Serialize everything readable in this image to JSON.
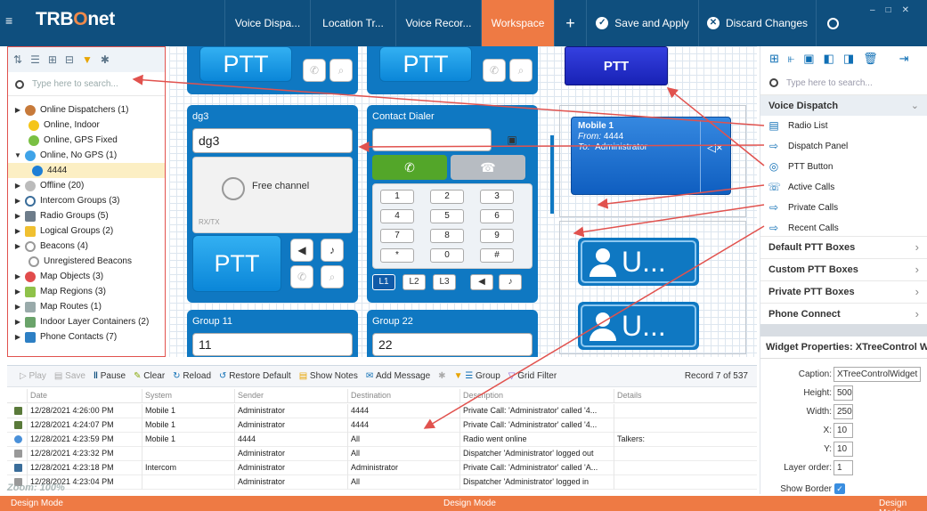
{
  "app": {
    "title_a": "TRB",
    "title_b": "O",
    "title_c": "net"
  },
  "tabs": [
    {
      "label": "Voice Dispa..."
    },
    {
      "label": "Location Tr..."
    },
    {
      "label": "Voice Recor..."
    },
    {
      "label": "Workspace"
    },
    {
      "label": "+"
    },
    {
      "label": "Save and Apply"
    },
    {
      "label": "Discard Changes"
    }
  ],
  "accent_color": "#ee7a44",
  "brand_color": "#0f4f7e",
  "left_panel": {
    "search_placeholder": "Type here to search...",
    "tree": [
      {
        "label": "Online Dispatchers (1)",
        "icon": "dispatcher-icon"
      },
      {
        "label": "Online, Indoor",
        "icon": "yellow-dot-icon"
      },
      {
        "label": "Online, GPS Fixed",
        "icon": "green-dot-icon"
      },
      {
        "label": "Online, No GPS (1)",
        "icon": "blue-dot-icon"
      },
      {
        "label": "4444",
        "icon": "walker-icon"
      },
      {
        "label": "Offline (20)",
        "icon": "grey-dot-icon"
      },
      {
        "label": "Intercom Groups (3)",
        "icon": "headset-icon"
      },
      {
        "label": "Radio Groups (5)",
        "icon": "radio-icon"
      },
      {
        "label": "Logical Groups (2)",
        "icon": "logical-icon"
      },
      {
        "label": "Beacons (4)",
        "icon": "beacon-icon"
      },
      {
        "label": "Unregistered Beacons",
        "icon": "beacon-icon"
      },
      {
        "label": "Map Objects (3)",
        "icon": "map-pin-icon"
      },
      {
        "label": "Map Regions (3)",
        "icon": "region-icon"
      },
      {
        "label": "Map Routes (1)",
        "icon": "route-icon"
      },
      {
        "label": "Indoor Layer Containers (2)",
        "icon": "indoor-icon"
      },
      {
        "label": "Phone Contacts (7)",
        "icon": "contacts-icon"
      }
    ]
  },
  "canvas": {
    "ptt_label": "PTT",
    "dg3_title": "dg3",
    "dg3_value": "dg3",
    "free_channel": "Free channel",
    "rxtx": "RX/TX",
    "contact_dialer_title": "Contact Dialer",
    "keys": [
      "1",
      "2",
      "3",
      "4",
      "5",
      "6",
      "7",
      "8",
      "9",
      "*",
      "0",
      "#"
    ],
    "lines": [
      "L1",
      "L2",
      "L3"
    ],
    "group11_title": "Group 11",
    "group11_value": "11",
    "group22_title": "Group 22",
    "group22_value": "22",
    "big_ptt": "PTT",
    "call_card": {
      "title": "Mobile 1",
      "from_label": "From:",
      "from_value": "4444",
      "to_label": "To:",
      "to_value": "Administrator"
    },
    "contact_tile_label": "U..."
  },
  "events": {
    "toolbar": {
      "play": "Play",
      "save": "Save",
      "pause": "Pause",
      "clear": "Clear",
      "reload": "Reload",
      "restore": "Restore Default",
      "show_notes": "Show Notes",
      "add_message": "Add Message",
      "group": "Group",
      "grid_filter": "Grid Filter",
      "record": "Record 7 of 537"
    },
    "columns": [
      "Date",
      "System",
      "Sender",
      "Destination",
      "Description",
      "Details"
    ],
    "rows": [
      {
        "icon": "radio-icon",
        "date": "12/28/2021 4:26:00 PM",
        "system": "Mobile 1",
        "sender": "Administrator",
        "destination": "4444",
        "description": "Private Call: 'Administrator' called '4...",
        "details": ""
      },
      {
        "icon": "radio-icon",
        "date": "12/28/2021 4:24:07 PM",
        "system": "Mobile 1",
        "sender": "Administrator",
        "destination": "4444",
        "description": "Private Call: 'Administrator' called '4...",
        "details": ""
      },
      {
        "icon": "info-icon",
        "date": "12/28/2021 4:23:59 PM",
        "system": "Mobile 1",
        "sender": "4444",
        "destination": "All",
        "description": "Radio went online",
        "details": "Talkers:"
      },
      {
        "icon": "logout-icon",
        "date": "12/28/2021 4:23:32 PM",
        "system": "",
        "sender": "Administrator",
        "destination": "All",
        "description": "Dispatcher 'Administrator' logged out",
        "details": ""
      },
      {
        "icon": "headset-icon",
        "date": "12/28/2021 4:23:18 PM",
        "system": "Intercom",
        "sender": "Administrator",
        "destination": "Administrator",
        "description": "Private Call: 'Administrator' called 'A...",
        "details": ""
      },
      {
        "icon": "login-icon",
        "date": "12/28/2021 4:23:04 PM",
        "system": "",
        "sender": "Administrator",
        "destination": "All",
        "description": "Dispatcher 'Administrator' logged in",
        "details": ""
      }
    ],
    "zoom_label": "Zoom: 100%"
  },
  "right_panel": {
    "search_placeholder": "Type here to search...",
    "voice_dispatch": "Voice Dispatch",
    "items": [
      {
        "label": "Radio List",
        "icon": "radio-list-icon"
      },
      {
        "label": "Dispatch Panel",
        "icon": "panel-icon"
      },
      {
        "label": "PTT Button",
        "icon": "ptt-icon"
      },
      {
        "label": "Active Calls",
        "icon": "active-calls-icon"
      },
      {
        "label": "Private Calls",
        "icon": "panel-icon"
      },
      {
        "label": "Recent Calls",
        "icon": "panel-icon"
      }
    ],
    "sections": [
      "Default PTT Boxes",
      "Custom PTT Boxes",
      "Private PTT Boxes",
      "Phone Connect"
    ],
    "props_title": "Widget Properties: XTreeControl W...",
    "props": [
      {
        "label": "Caption:",
        "value": "XTreeControlWidget"
      },
      {
        "label": "Height:",
        "value": "500"
      },
      {
        "label": "Width:",
        "value": "250"
      },
      {
        "label": "X:",
        "value": "10"
      },
      {
        "label": "Y:",
        "value": "10"
      },
      {
        "label": "Layer order:",
        "value": "1"
      }
    ],
    "show_border_label": "Show Border"
  },
  "status": {
    "left": "Design Mode",
    "center": "Design Mode",
    "right": "Design Mode"
  }
}
